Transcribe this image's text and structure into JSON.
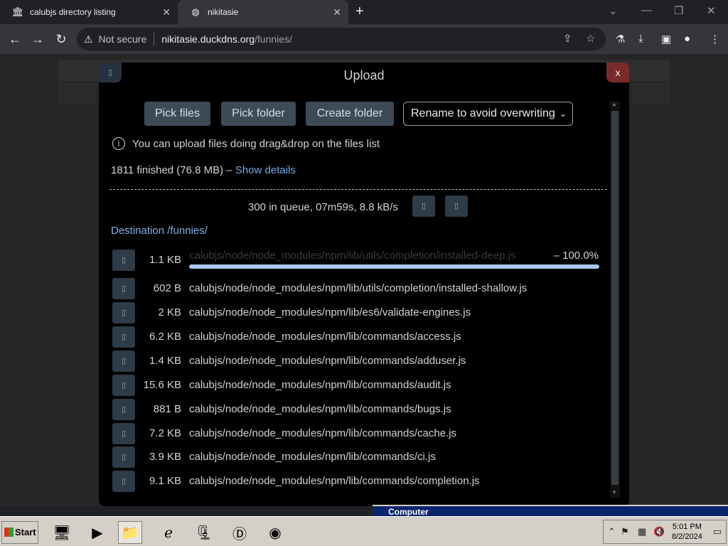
{
  "browser": {
    "tabs": [
      {
        "title": "calubjs directory listing",
        "icon": "bank-icon"
      },
      {
        "title": "nikitasie",
        "icon": "globe-icon"
      }
    ],
    "security_label": "Not secure",
    "url_host": "nikitasie.duckdns.org",
    "url_path": "/funnies/"
  },
  "upload": {
    "title": "Upload",
    "close_label": "x",
    "pick_files": "Pick files",
    "pick_folder": "Pick folder",
    "create_folder": "Create folder",
    "conflict_mode": "Rename to avoid overwriting",
    "info_text": "You can upload files doing drag&drop on the files list",
    "finished_text": "1811 finished (76.8 MB) –",
    "show_details": "Show details",
    "queue_text": "300 in queue, 07m59s, 8.8 kB/s",
    "destination": "Destination /funnies/",
    "files": [
      {
        "size": "1.1 KB",
        "path": "calubjs/node/node_modules/npm/lib/utils/completion/installed-deep.js",
        "progress": "– 100.0%",
        "progress_value": 1.0
      },
      {
        "size": "602 B",
        "path": "calubjs/node/node_modules/npm/lib/utils/completion/installed-shallow.js"
      },
      {
        "size": "2 KB",
        "path": "calubjs/node/node_modules/npm/lib/es6/validate-engines.js"
      },
      {
        "size": "6.2 KB",
        "path": "calubjs/node/node_modules/npm/lib/commands/access.js"
      },
      {
        "size": "1.4 KB",
        "path": "calubjs/node/node_modules/npm/lib/commands/adduser.js"
      },
      {
        "size": "15.6 KB",
        "path": "calubjs/node/node_modules/npm/lib/commands/audit.js"
      },
      {
        "size": "881 B",
        "path": "calubjs/node/node_modules/npm/lib/commands/bugs.js"
      },
      {
        "size": "7.2 KB",
        "path": "calubjs/node/node_modules/npm/lib/commands/cache.js"
      },
      {
        "size": "3.9 KB",
        "path": "calubjs/node/node_modules/npm/lib/commands/ci.js"
      },
      {
        "size": "9.1 KB",
        "path": "calubjs/node/node_modules/npm/lib/commands/completion.js"
      }
    ]
  },
  "background_window": {
    "title": "Computer"
  },
  "taskbar": {
    "start_label": "Start",
    "time": "5:01 PM",
    "date": "8/2/2024"
  }
}
